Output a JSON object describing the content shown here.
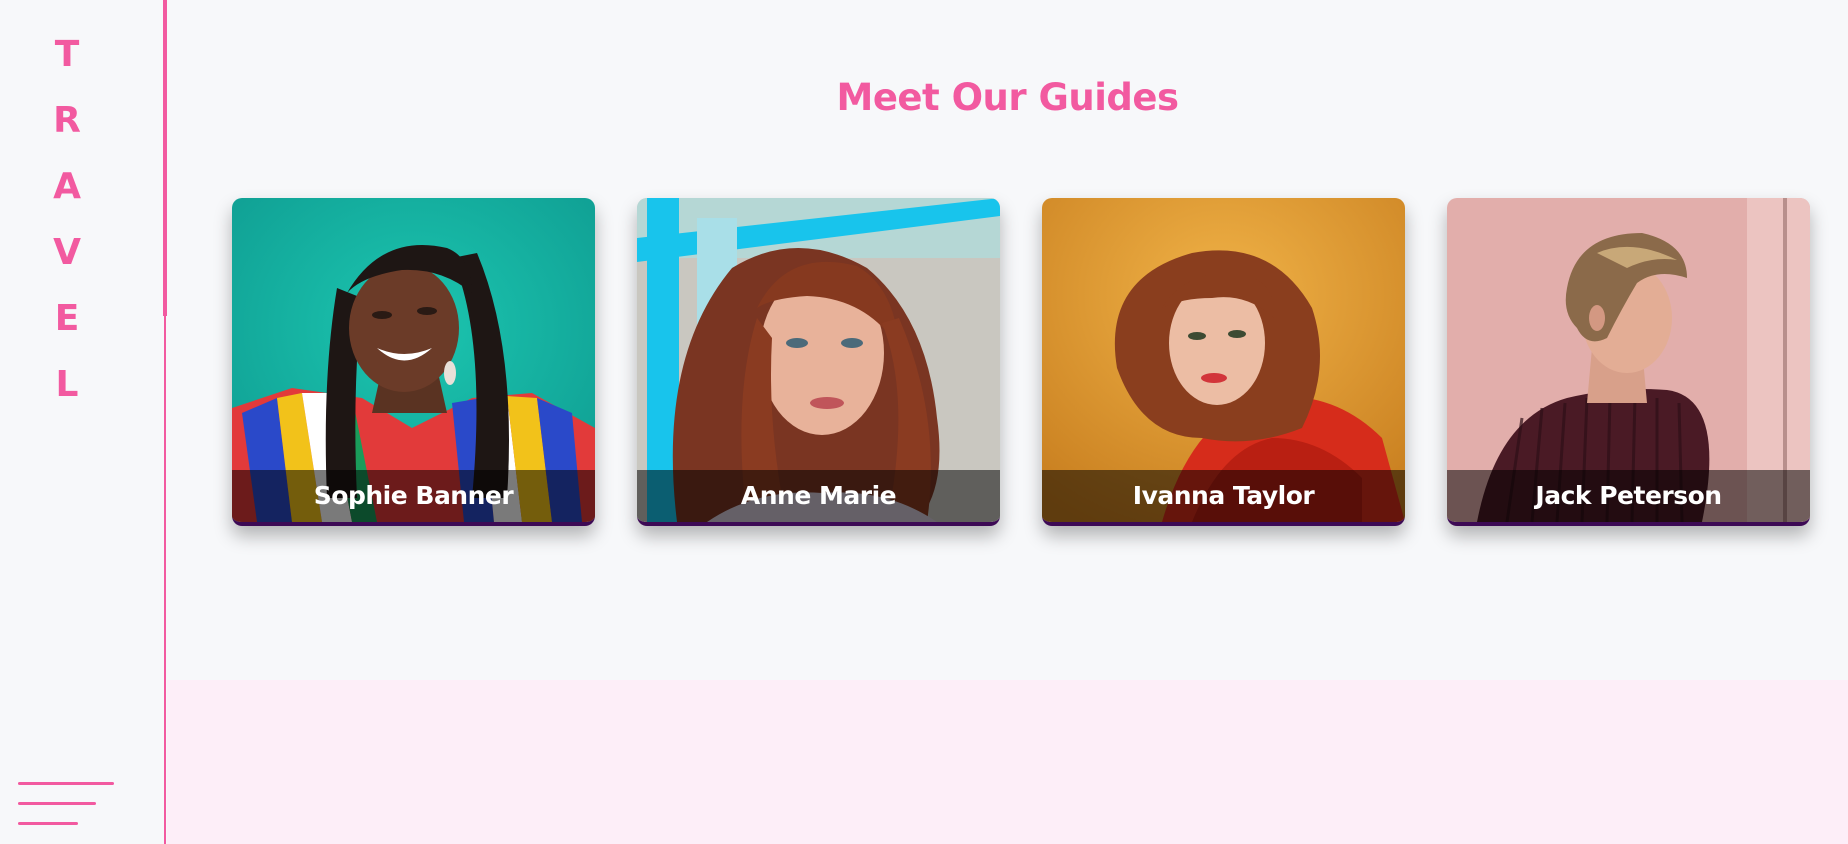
{
  "sidebar": {
    "brand_letters": [
      "T",
      "R",
      "A",
      "V",
      "E",
      "L"
    ],
    "menu_icon": "hamburger-menu-icon"
  },
  "main": {
    "heading": "Meet Our Guides",
    "guides": [
      {
        "name": "Sophie Banner"
      },
      {
        "name": "Anne Marie"
      },
      {
        "name": "Ivanna Taylor"
      },
      {
        "name": "Jack Peterson"
      }
    ]
  },
  "colors": {
    "accent": "#f25aa0",
    "card_border": "#3d0a55",
    "footer_band": "#fdeef8",
    "background": "#f7f8fa"
  }
}
